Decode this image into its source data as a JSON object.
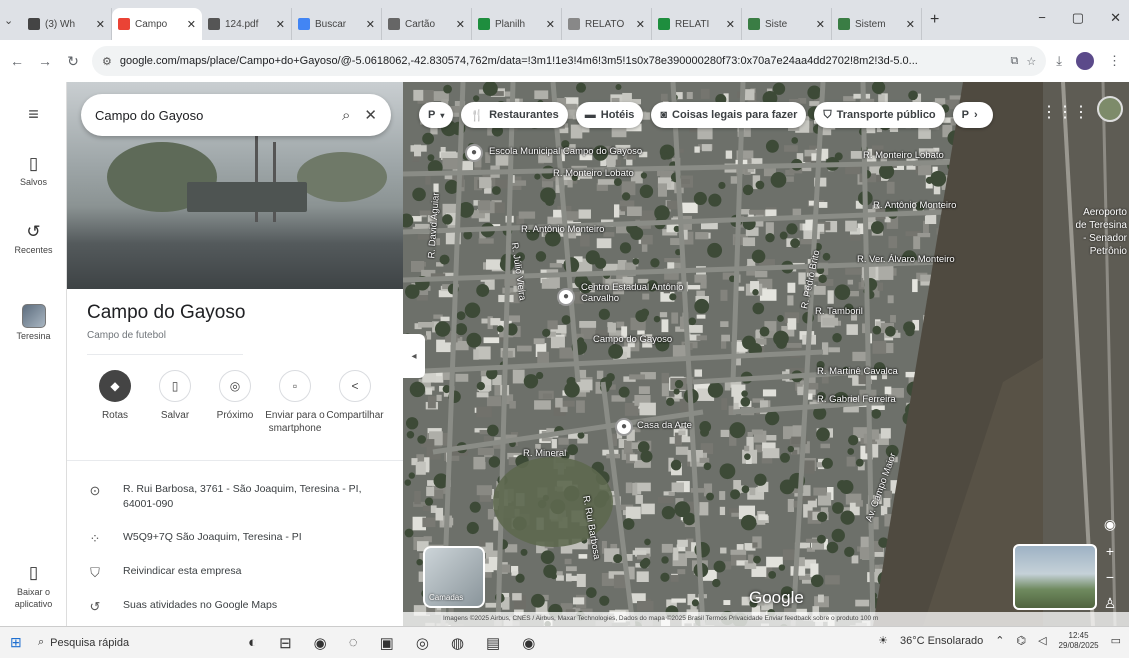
{
  "browser": {
    "tabs": [
      {
        "title": "(3) Wh",
        "color": "#444444"
      },
      {
        "title": "Campo",
        "color": "#ea4335",
        "active": true
      },
      {
        "title": "124.pdf",
        "color": "#555555"
      },
      {
        "title": "Buscar",
        "color": "#4285f4"
      },
      {
        "title": "Cartão",
        "color": "#666666"
      },
      {
        "title": "Planilh",
        "color": "#1e8e3e"
      },
      {
        "title": "RELATÓ",
        "color": "#888888"
      },
      {
        "title": "RELATI",
        "color": "#1e8e3e"
      },
      {
        "title": "Siste",
        "color": "#3a7d44"
      },
      {
        "title": "Sistem",
        "color": "#3a7d44"
      }
    ],
    "url": "google.com/maps/place/Campo+do+Gayoso/@-5.0618062,-42.830574,762m/data=!3m1!1e3!4m6!3m5!1s0x78e390000280f73:0x70a7e24aa4dd2702!8m2!3d-5.0..."
  },
  "rail": {
    "menu_icon": "menu-icon",
    "items": [
      {
        "label": "Salvos",
        "icon": "bookmark-icon"
      },
      {
        "label": "Recentes",
        "icon": "history-icon"
      },
      {
        "label": "Teresina",
        "icon": "place-thumb"
      },
      {
        "label": "Baixar o aplicativo",
        "icon": "phone-icon"
      }
    ]
  },
  "search": {
    "value": "Campo do Gayoso"
  },
  "place": {
    "title": "Campo do Gayoso",
    "category": "Campo de futebol",
    "actions": [
      {
        "label": "Rotas",
        "icon": "directions-icon"
      },
      {
        "label": "Salvar",
        "icon": "bookmark-icon"
      },
      {
        "label": "Próximo",
        "icon": "nearby-icon"
      },
      {
        "label": "Enviar para o smartphone",
        "icon": "send-to-phone-icon"
      },
      {
        "label": "Compartilhar",
        "icon": "share-icon"
      }
    ],
    "info": [
      {
        "icon": "location-pin-icon",
        "text": "R. Rui Barbosa, 3761 - São Joaquim, Teresina - PI, 64001-090"
      },
      {
        "icon": "plus-code-icon",
        "text": "W5Q9+7Q São Joaquim, Teresina - PI"
      },
      {
        "icon": "shield-icon",
        "text": "Reivindicar esta empresa"
      },
      {
        "icon": "history-icon",
        "text": "Suas atividades no Google Maps"
      }
    ]
  },
  "map": {
    "chips": [
      {
        "label": "Restaurantes",
        "icon": "restaurant-icon"
      },
      {
        "label": "Hotéis",
        "icon": "hotel-icon"
      },
      {
        "label": "Coisas legais para fazer",
        "icon": "camera-icon"
      },
      {
        "label": "Transporte público",
        "icon": "transit-icon"
      },
      {
        "label": "P",
        "icon": "parking-icon"
      }
    ],
    "layer_chip": "P",
    "streets": [
      "R. Monteiro Lobato",
      "R. Monteiro Lobato",
      "R. Antônio Monteiro",
      "R. Antônio Monteiro",
      "R. Ver. Álvaro Monteiro",
      "R. Tamboril",
      "R. Martinê Cavalca",
      "R. Gabriel Ferreira",
      "R. Mineral",
      "R. Rui Barbosa",
      "Av. Campo Maior",
      "R. Júlio Vieira",
      "R. Pedro Brito",
      "R. David Aguiar"
    ],
    "pois": [
      {
        "label": "Escola Municipal Campo do Gayoso"
      },
      {
        "label": "Centro Estadual Antônio Carvalho"
      },
      {
        "label": "Campo do Gayoso"
      },
      {
        "label": "Casa da Arte"
      }
    ],
    "airport": "Aeroporto de Teresina - Senador Petrônio",
    "layers_label": "Camadas",
    "google": "Google",
    "attribution": "Imagens ©2025 Airbus, CNES / Airbus, Maxar Technologies, Dados do mapa ©2025    Brasil   Termos   Privacidade   Enviar feedback sobre o produto   100 m"
  },
  "taskbar": {
    "search_placeholder": "Pesquisa rápida",
    "weather": "36°C Ensolarado",
    "time": "12:45",
    "date": "29/08/2025"
  }
}
